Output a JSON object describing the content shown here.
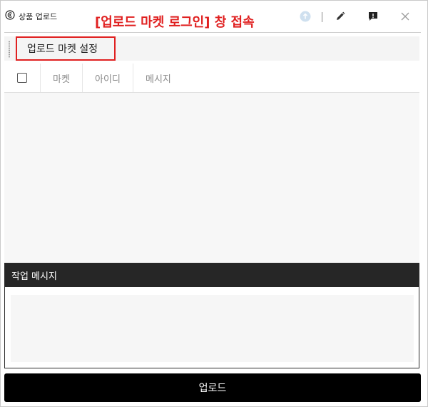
{
  "window": {
    "title": "상품 업로드",
    "annotation": "[업로드 마켓 로그인] 창 접속"
  },
  "toolbar": {
    "market_settings_label": "업로드 마켓 설정"
  },
  "table": {
    "columns": [
      "마켓",
      "아이디",
      "메시지"
    ],
    "rows": []
  },
  "work_messages": {
    "title": "작업 메시지"
  },
  "upload": {
    "label": "업로드"
  },
  "colors": {
    "annotation": "#e02020",
    "header_dark": "#262626",
    "upload_button": "#000000"
  },
  "icons": {
    "logo": "app-logo-icon",
    "status": "upload-status-icon",
    "edit": "pencil-icon",
    "report": "alert-icon",
    "close": "close-icon"
  }
}
